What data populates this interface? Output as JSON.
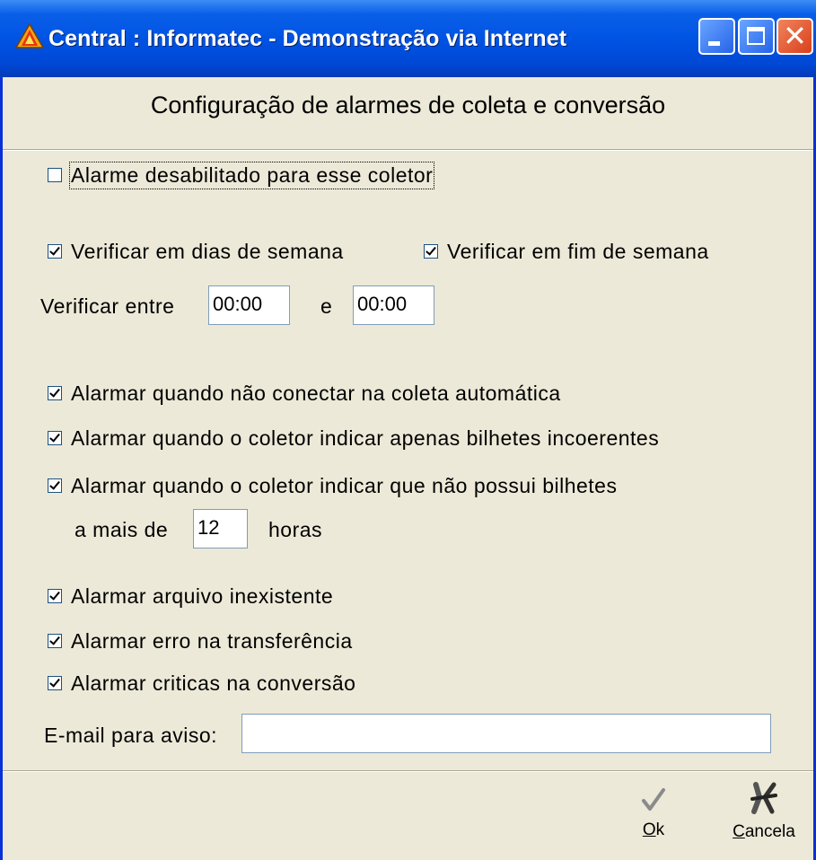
{
  "window": {
    "title": "Central : Informatec - Demonstração via Internet"
  },
  "heading": "Configuração de alarmes de coleta e conversão",
  "alarm_disabled": {
    "label": "Alarme desabilitado para esse coletor",
    "checked": false
  },
  "weekdays": {
    "label": "Verificar em dias de semana",
    "checked": true
  },
  "weekend": {
    "label": "Verificar em fim de semana",
    "checked": true
  },
  "time_range": {
    "label": "Verificar entre",
    "from": "00:00",
    "connector": "e",
    "to": "00:00"
  },
  "alarms": [
    {
      "label": "Alarmar quando não conectar na coleta automática",
      "checked": true
    },
    {
      "label": "Alarmar quando o coletor indicar apenas bilhetes incoerentes",
      "checked": true
    },
    {
      "label": "Alarmar quando o coletor indicar que não possui bilhetes",
      "checked": true
    }
  ],
  "hours": {
    "prefix": "a mais de",
    "value": "12",
    "suffix": "horas"
  },
  "file_alarms": [
    {
      "label": "Alarmar arquivo inexistente",
      "checked": true
    },
    {
      "label": "Alarmar erro na transferência",
      "checked": true
    },
    {
      "label": "Alarmar criticas na conversão",
      "checked": true
    }
  ],
  "email": {
    "label": "E-mail para aviso:",
    "value": ""
  },
  "buttons": {
    "ok": {
      "mnemonic": "O",
      "rest": "k"
    },
    "cancel": {
      "mnemonic": "C",
      "rest": "ancela"
    }
  }
}
